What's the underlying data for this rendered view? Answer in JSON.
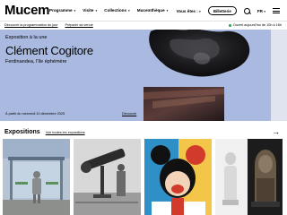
{
  "header": {
    "logo": "Mucem",
    "nav": [
      "Programme",
      "Visite",
      "Collections",
      "Mucemthèque"
    ],
    "vous_etes": "Vous êtes :",
    "billetterie": "Billetterie",
    "lang": "FR"
  },
  "subnav": {
    "links": [
      "Découvrir la programmation du jour",
      "Préparer sa venue"
    ],
    "open_now": "Ouvert aujourd'hui de 10h à 18h"
  },
  "hero": {
    "label": "Exposition à la une",
    "title": "Clément Cogitore",
    "subtitle": "Ferdinandea, l’île éphémère",
    "date": "À partir du mercredi 10 décembre 2025",
    "cta": "Découvrir"
  },
  "expositions": {
    "title": "Expositions",
    "link": "Voir toutes les expositions"
  },
  "colors": {
    "hero_bg": "#a9b9df",
    "open_dot": "#1ca84d"
  }
}
